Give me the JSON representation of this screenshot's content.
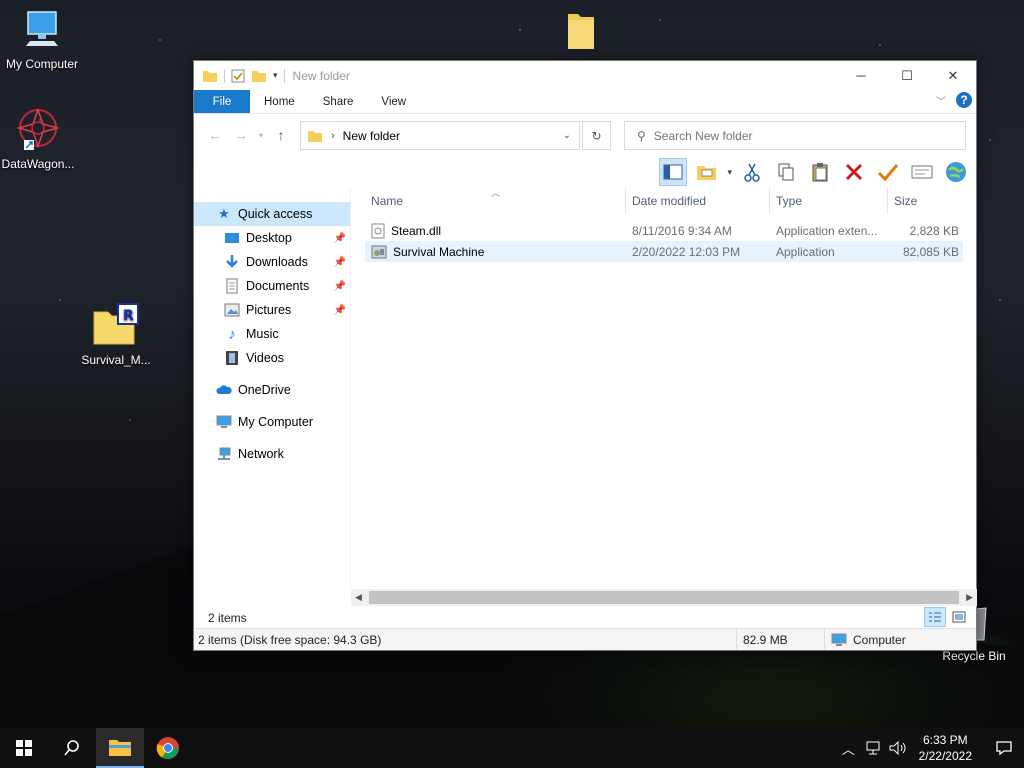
{
  "desktop": {
    "icons": [
      {
        "label": "My Computer"
      },
      {
        "label": "DataWagon..."
      },
      {
        "label": "Survival_M..."
      },
      {
        "label": "Recycle Bin"
      }
    ]
  },
  "window": {
    "title": "New folder",
    "ribbon_tabs": [
      "File",
      "Home",
      "Share",
      "View"
    ],
    "address": {
      "crumb": "New folder"
    },
    "search_placeholder": "Search New folder",
    "columns": [
      "Name",
      "Date modified",
      "Type",
      "Size"
    ],
    "files": [
      {
        "name": "Steam.dll",
        "date": "8/11/2016 9:34 AM",
        "type": "Application exten...",
        "size": "2,828 KB",
        "icon": "dll-file-icon"
      },
      {
        "name": "Survival Machine",
        "date": "2/20/2022 12:03 PM",
        "type": "Application",
        "size": "82,085 KB",
        "icon": "application-icon"
      }
    ],
    "nav": {
      "quick_access": "Quick access",
      "items": [
        "Desktop",
        "Downloads",
        "Documents",
        "Pictures",
        "Music",
        "Videos"
      ],
      "onedrive": "OneDrive",
      "my_computer": "My Computer",
      "network": "Network"
    },
    "status": {
      "count": "2 items"
    },
    "info": {
      "free_space": "2 items (Disk free space: 94.3 GB)",
      "size": "82.9 MB",
      "location": "Computer"
    }
  },
  "taskbar": {
    "time": "6:33 PM",
    "date": "2/22/2022"
  },
  "colors": {
    "accent": "#1979ca",
    "selection": "#cce8ff"
  }
}
